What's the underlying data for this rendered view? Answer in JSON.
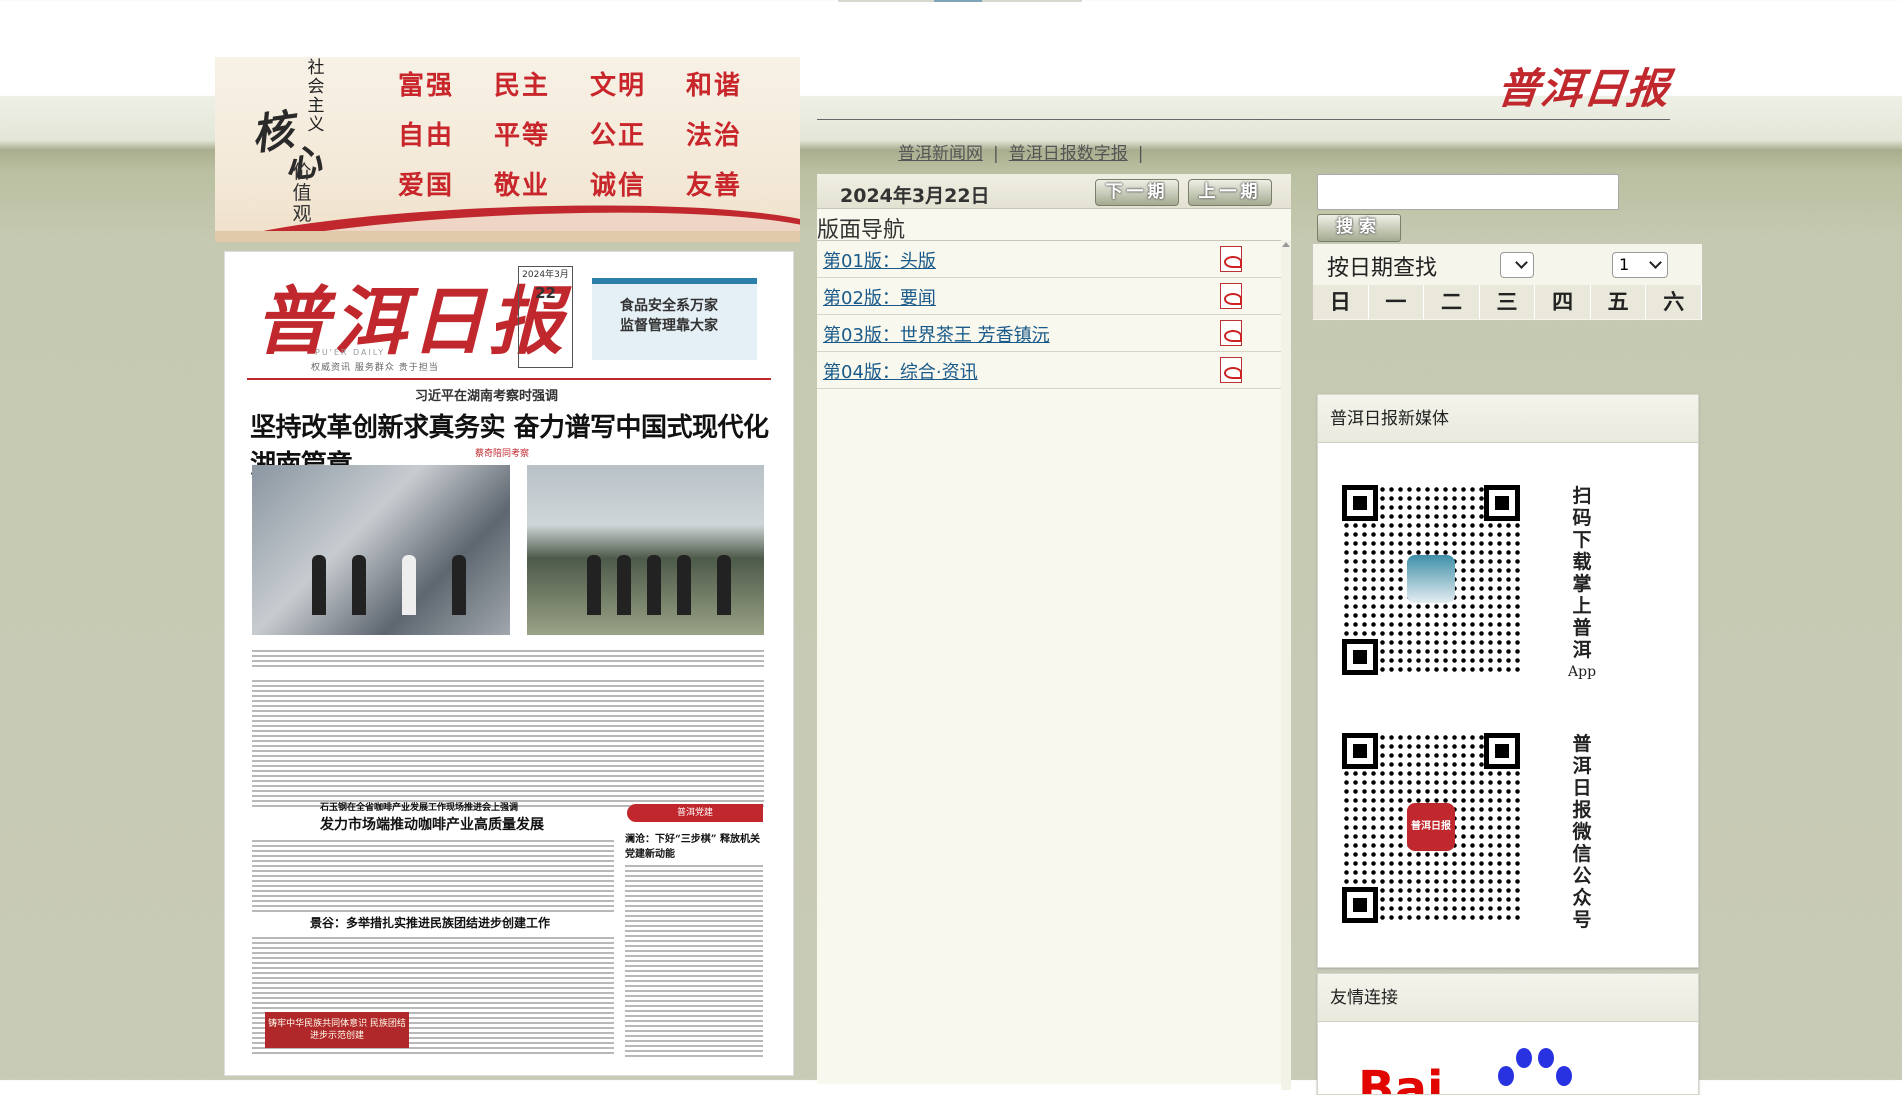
{
  "banner": {
    "side_top": "社会主义",
    "big_he": "核",
    "big_xin": "心",
    "side_bottom": "价值观",
    "values": [
      "富强",
      "民主",
      "文明",
      "和谐",
      "自由",
      "平等",
      "公正",
      "法治",
      "爱国",
      "敬业",
      "诚信",
      "友善"
    ]
  },
  "header": {
    "logo": "普洱日报",
    "links": [
      "普洱新闻网",
      "普洱日报数字报"
    ],
    "sep": "|"
  },
  "newspaper": {
    "title": "普洱日报",
    "subtitle": "PU'ER DAILY",
    "motto": "权威资讯  服务群众  贵于担当",
    "date_month": "2024年3月",
    "date_day": "22",
    "ad_line1": "食品安全系万家",
    "ad_line2": "监督管理靠大家",
    "kicker": "习近平在湖南考察时强调",
    "headline": "坚持改革创新求真务实  奋力谱写中国式现代化湖南篇章",
    "byline": "蔡奇陪同考察",
    "head2": "发力市场端推动咖啡产业高质量发展",
    "head2_kicker": "石玉钢在全省咖啡产业发展工作现场推进会上强调",
    "head3": "澜沧：下好“三步棋”  释放机关党建新动能",
    "head4": "景谷：多举措扎实推进民族团结进步创建工作",
    "tag": "普洱党建",
    "banner2": "铸牢中华民族共同体意识 民族团结进步示范创建"
  },
  "nav": {
    "date": "2024年3月22日",
    "next_label": "下一期",
    "prev_label": "上一期",
    "heading": "版面导航",
    "pages": [
      {
        "label": "第01版：头版"
      },
      {
        "label": "第02版：要闻"
      },
      {
        "label": "第03版：世界茶王 芳香镇沅"
      },
      {
        "label": "第04版：综合·资讯"
      }
    ]
  },
  "search": {
    "value": "",
    "button_label": "搜索"
  },
  "calendar": {
    "label": "按日期查找",
    "month_value": "",
    "day_value": "1",
    "weekdays": [
      "日",
      "一",
      "二",
      "三",
      "四",
      "五",
      "六"
    ]
  },
  "media": {
    "title": "普洱日报新媒体",
    "qr1_text": "扫码下载掌上普洱",
    "qr1_app": "App",
    "qr2_text": "普洱日报微信公众号",
    "qr2_logo": "普洱日报"
  },
  "links": {
    "title": "友情连接",
    "baidu": "Bai"
  },
  "colors": {
    "brand_red": "#c0282d",
    "link_blue": "#1a5a8a",
    "panel_bg": "#f9f8ee"
  }
}
